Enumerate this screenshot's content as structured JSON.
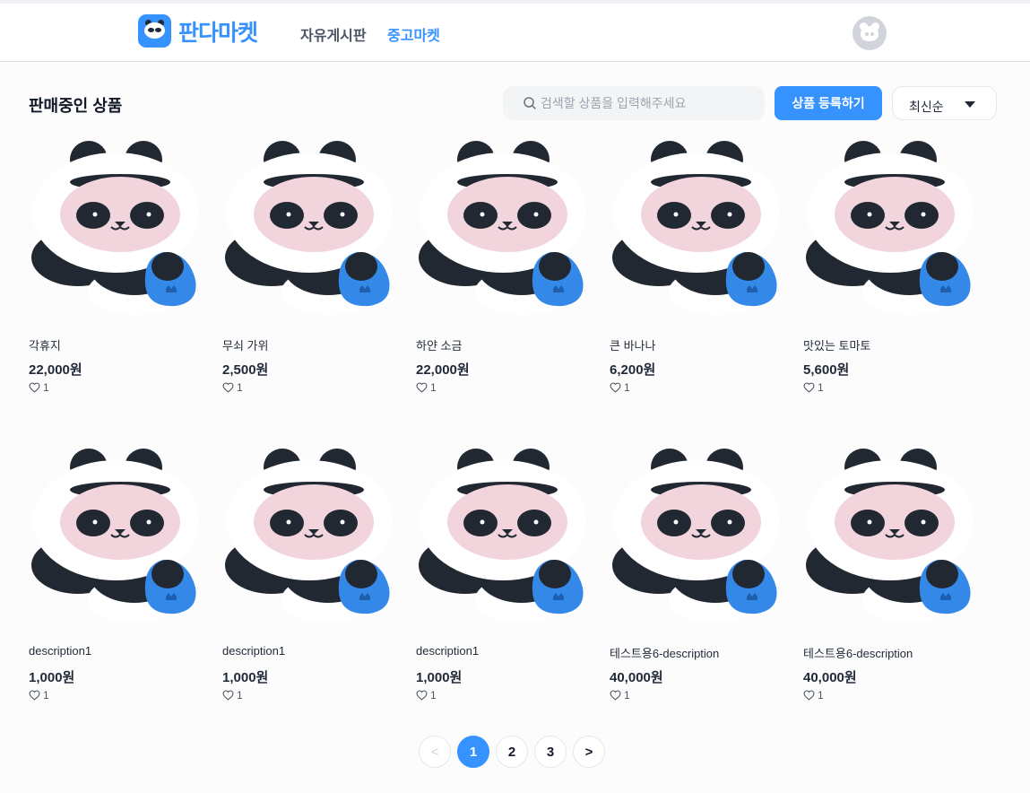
{
  "header": {
    "logo_text": "판다마켓",
    "nav": [
      {
        "label": "자유게시판",
        "active": false
      },
      {
        "label": "중고마켓",
        "active": true
      }
    ]
  },
  "main": {
    "section_title": "판매중인 상품",
    "search": {
      "placeholder": "검색할 상품을 입력해주세요",
      "value": ""
    },
    "register_button": "상품 등록하기",
    "sort": {
      "selected": "최신순"
    }
  },
  "products": [
    {
      "name": "각휴지",
      "price": "22,000원",
      "likes": "1"
    },
    {
      "name": "무쇠 가위",
      "price": "2,500원",
      "likes": "1"
    },
    {
      "name": "하얀 소금",
      "price": "22,000원",
      "likes": "1"
    },
    {
      "name": "큰 바나나",
      "price": "6,200원",
      "likes": "1"
    },
    {
      "name": "맛있는 토마토",
      "price": "5,600원",
      "likes": "1"
    },
    {
      "name": "description1",
      "price": "1,000원",
      "likes": "1"
    },
    {
      "name": "description1",
      "price": "1,000원",
      "likes": "1"
    },
    {
      "name": "description1",
      "price": "1,000원",
      "likes": "1"
    },
    {
      "name": "테스트용6-description",
      "price": "40,000원",
      "likes": "1"
    },
    {
      "name": "테스트용6-description",
      "price": "40,000원",
      "likes": "1"
    }
  ],
  "pagination": {
    "prev": "<",
    "pages": [
      "1",
      "2",
      "3"
    ],
    "current": "1",
    "next": ">"
  },
  "colors": {
    "accent": "#3692ff"
  }
}
